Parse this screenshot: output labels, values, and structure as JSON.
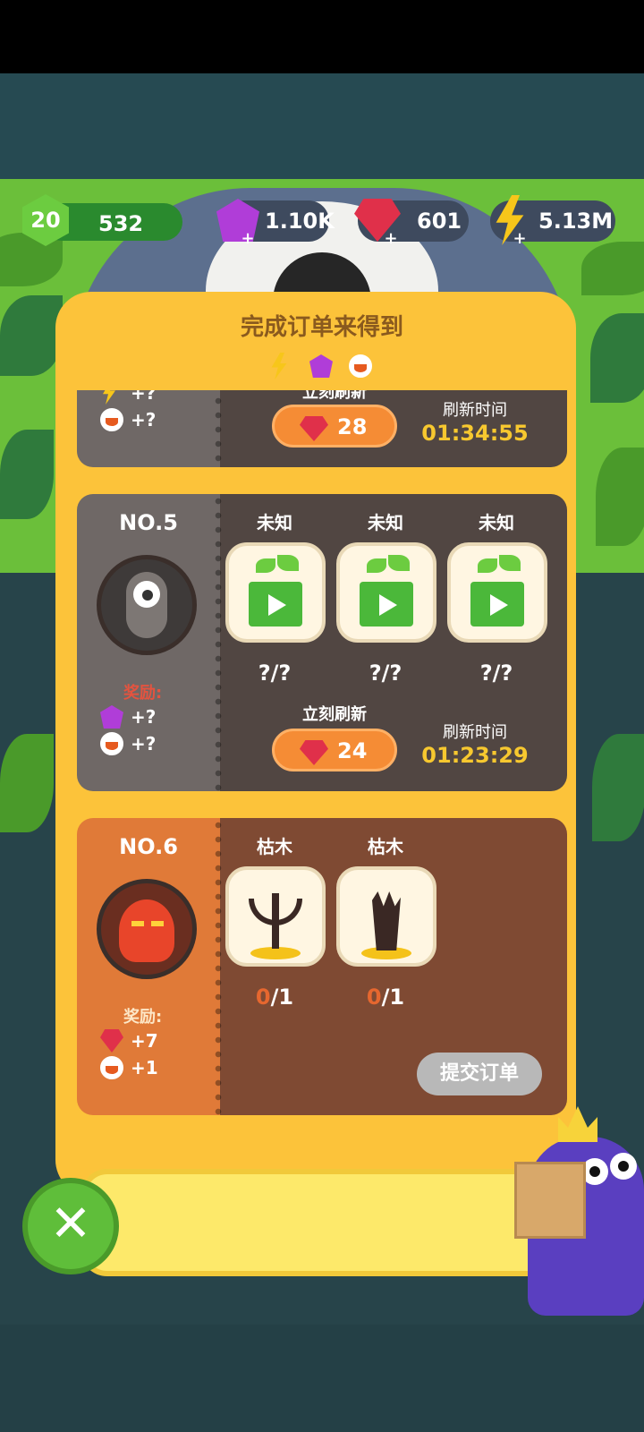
{
  "hud": {
    "level": "20",
    "xp": "532",
    "purple_gems": "1.10K",
    "red_gems": "601",
    "energy": "5.13M"
  },
  "panel": {
    "title": "完成订单来得到",
    "reward_icons": [
      "bolt-icon",
      "purple-gem-icon",
      "potion-icon"
    ]
  },
  "orders": [
    {
      "rewards": [
        {
          "icon": "bolt-icon",
          "text": "+?"
        },
        {
          "icon": "potion-icon",
          "text": "+?"
        }
      ],
      "refresh_label": "立刻刷新",
      "refresh_cost": "28",
      "timer_label": "刷新时间",
      "timer": "01:34:55"
    },
    {
      "no": "NO.5",
      "reward_label": "奖励:",
      "rewards": [
        {
          "icon": "purple-gem-icon",
          "text": "+?"
        },
        {
          "icon": "potion-icon",
          "text": "+?"
        }
      ],
      "requirements": [
        {
          "name": "未知",
          "count": "?/?",
          "icon": "sprout-play-icon"
        },
        {
          "name": "未知",
          "count": "?/?",
          "icon": "sprout-play-icon"
        },
        {
          "name": "未知",
          "count": "?/?",
          "icon": "sprout-play-icon"
        }
      ],
      "refresh_label": "立刻刷新",
      "refresh_cost": "24",
      "timer_label": "刷新时间",
      "timer": "01:23:29"
    },
    {
      "no": "NO.6",
      "reward_label": "奖励:",
      "rewards": [
        {
          "icon": "red-gem-icon",
          "text": "+7"
        },
        {
          "icon": "potion-icon",
          "text": "+1"
        }
      ],
      "requirements": [
        {
          "name": "枯木",
          "have": "0",
          "need": "/1",
          "icon": "dead-tree-icon"
        },
        {
          "name": "枯木",
          "have": "0",
          "need": "/1",
          "icon": "dead-trunk-icon"
        }
      ],
      "submit_label": "提交订单"
    }
  ],
  "colors": {
    "panel": "#fcc33a",
    "card_dark": "#514642",
    "card_left_dark": "#6f6866",
    "card_brown": "#7f4a33",
    "card_left_orange": "#e07a38",
    "timer": "#f7c82f"
  }
}
